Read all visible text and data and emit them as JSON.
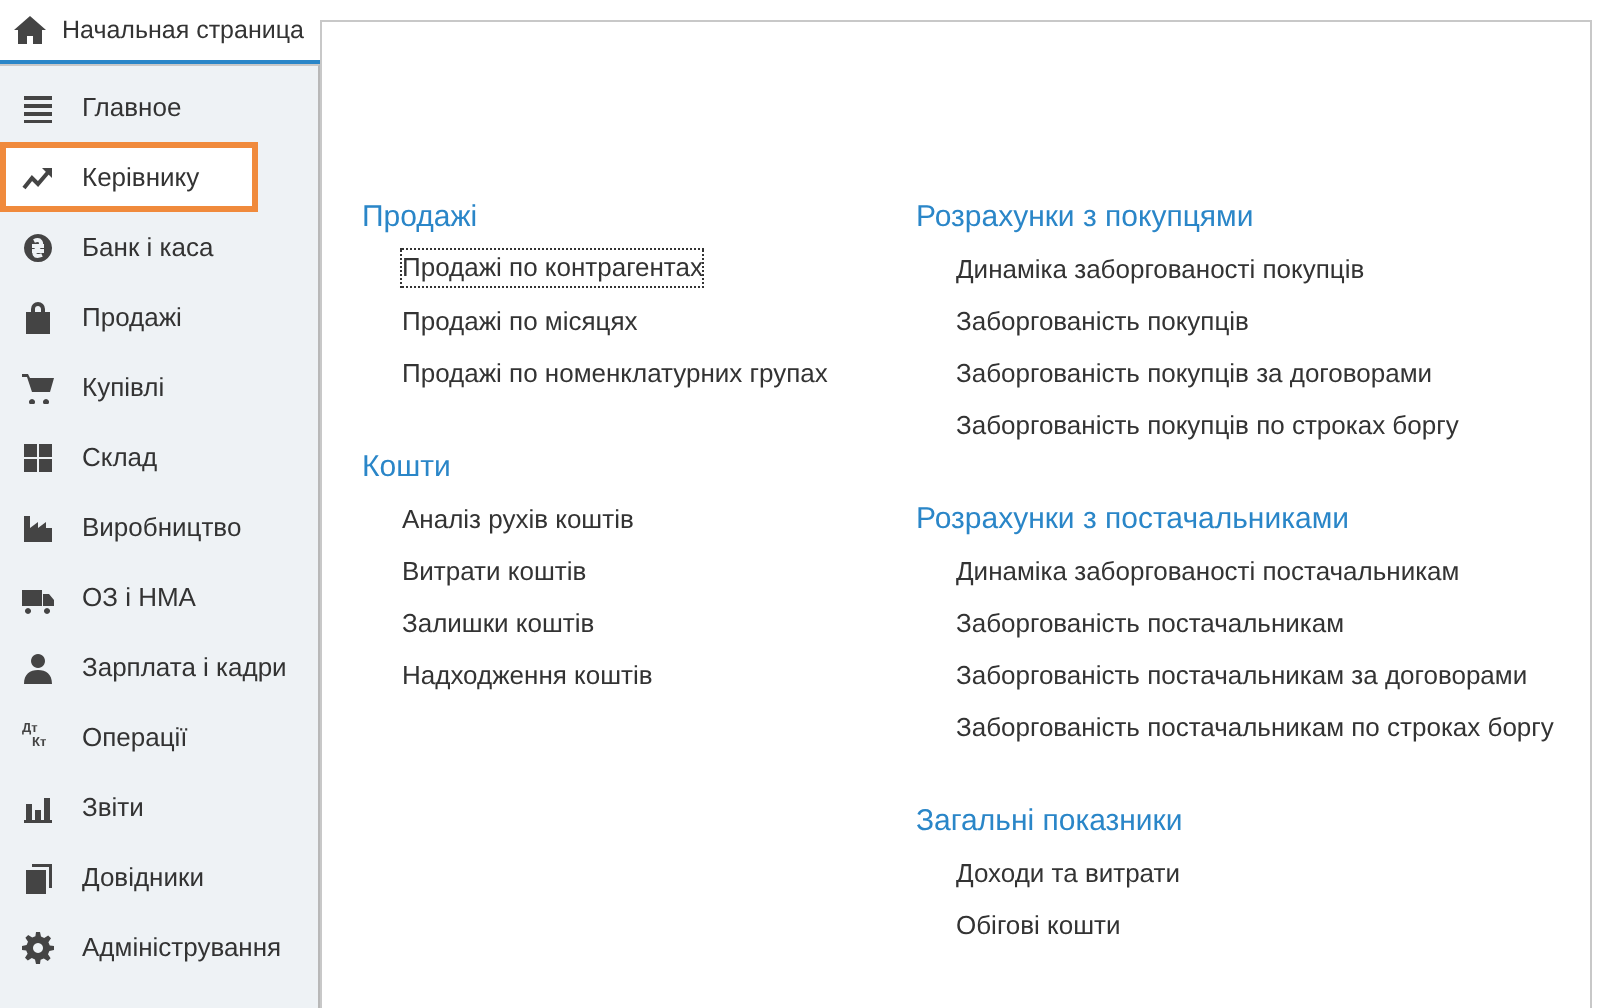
{
  "home_tab": {
    "label": "Начальная страница"
  },
  "sidebar": {
    "items": [
      {
        "label": "Главное",
        "selected": false
      },
      {
        "label": "Керівнику",
        "selected": true
      },
      {
        "label": "Банк і каса",
        "selected": false
      },
      {
        "label": "Продажі",
        "selected": false
      },
      {
        "label": "Купівлі",
        "selected": false
      },
      {
        "label": "Склад",
        "selected": false
      },
      {
        "label": "Виробництво",
        "selected": false
      },
      {
        "label": "ОЗ і НМА",
        "selected": false
      },
      {
        "label": "Зарплата і кадри",
        "selected": false
      },
      {
        "label": "Операції",
        "selected": false,
        "icon_text": [
          "Дт",
          "Кт"
        ]
      },
      {
        "label": "Звіти",
        "selected": false
      },
      {
        "label": "Довідники",
        "selected": false
      },
      {
        "label": "Адміністрування",
        "selected": false
      }
    ]
  },
  "columns": [
    {
      "sections": [
        {
          "title": "Продажі",
          "links": [
            {
              "label": "Продажі по контрагентах",
              "focused": true
            },
            {
              "label": "Продажі по місяцях",
              "focused": false
            },
            {
              "label": "Продажі по номенклатурних групах",
              "focused": false
            }
          ]
        },
        {
          "title": "Кошти",
          "links": [
            {
              "label": "Аналіз рухів коштів",
              "focused": false
            },
            {
              "label": "Витрати коштів",
              "focused": false
            },
            {
              "label": "Залишки коштів",
              "focused": false
            },
            {
              "label": "Надходження коштів",
              "focused": false
            }
          ]
        }
      ]
    },
    {
      "sections": [
        {
          "title": "Розрахунки з покупцями",
          "links": [
            {
              "label": "Динаміка заборгованості покупців",
              "focused": false
            },
            {
              "label": "Заборгованість покупців",
              "focused": false
            },
            {
              "label": "Заборгованість покупців за договорами",
              "focused": false
            },
            {
              "label": "Заборгованість покупців по строках боргу",
              "focused": false
            }
          ]
        },
        {
          "title": "Розрахунки з постачальниками",
          "links": [
            {
              "label": "Динаміка заборгованості постачальникам",
              "focused": false
            },
            {
              "label": "Заборгованість постачальникам",
              "focused": false
            },
            {
              "label": "Заборгованість постачальникам за договорами",
              "focused": false
            },
            {
              "label": "Заборгованість постачальникам по строках боргу",
              "focused": false
            }
          ]
        },
        {
          "title": "Загальні показники",
          "links": [
            {
              "label": "Доходи та витрати",
              "focused": false
            },
            {
              "label": "Обігові кошти",
              "focused": false
            }
          ]
        }
      ]
    }
  ]
}
